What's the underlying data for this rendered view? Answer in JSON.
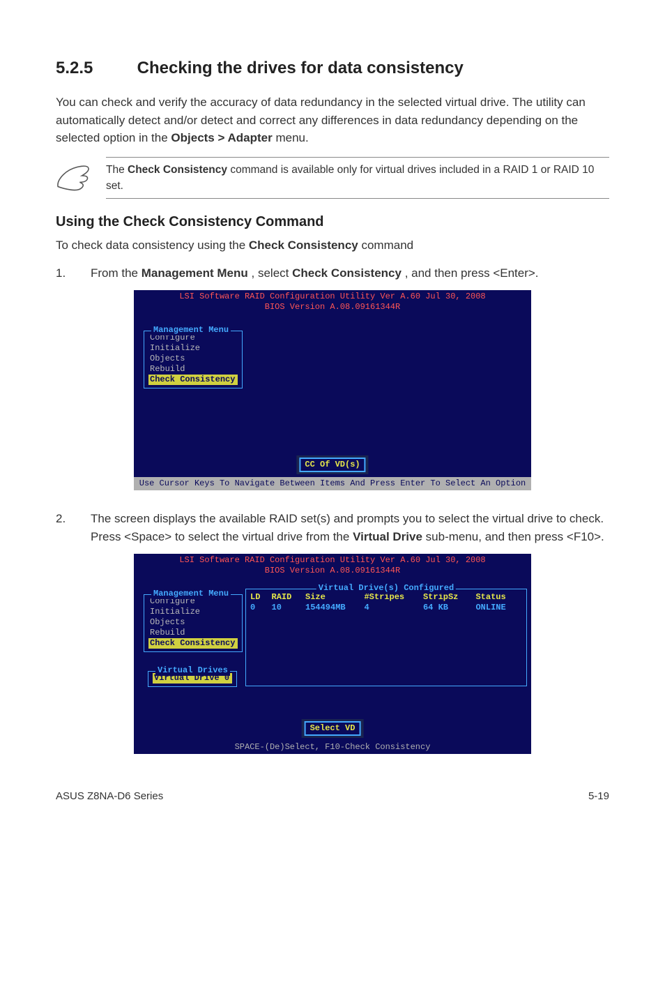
{
  "section": {
    "num": "5.2.5",
    "title": "Checking the drives for data consistency"
  },
  "intro": {
    "t1": "You can check and verify the accuracy of data redundancy in the selected virtual drive. The utility can automatically detect and/or detect and correct any differences in data redundancy depending on the selected option in the ",
    "b1": "Objects > Adapter",
    "t2": " menu."
  },
  "note": {
    "t1": "The ",
    "b1": "Check Consistency",
    "t2": " command is available only for virtual drives included in a RAID 1 or RAID 10 set."
  },
  "sub": {
    "title": "Using the Check Consistency Command"
  },
  "substep": {
    "t1": "To check data consistency using the ",
    "b1": "Check Consistency",
    "t2": " command"
  },
  "steps": {
    "s1": {
      "num": "1.",
      "t1": "From the ",
      "b1": "Management Menu",
      "t2": ", select ",
      "b2": "Check Consistency",
      "t3": ", and then press <Enter>."
    },
    "s2": {
      "num": "2.",
      "t1": "The screen displays the available RAID set(s) and prompts you to select the virtual drive to check. Press <Space> to select the virtual drive from the ",
      "b1": "Virtual Drive",
      "t2": " sub-menu, and then press <F10>."
    }
  },
  "bios1": {
    "hdr1": "LSI Software RAID Configuration Utility Ver A.60 Jul 30, 2008",
    "hdr2": "BIOS Version   A.08.09161344R",
    "menuTitle": "Management Menu",
    "items": {
      "i0": "Configure",
      "i1": "Initialize",
      "i2": "Objects",
      "i3": "Rebuild",
      "i4": "Check Consistency"
    },
    "cc": "CC Of VD(s)",
    "footer": "Use Cursor Keys To Navigate Between Items And Press Enter To Select An Option"
  },
  "bios2": {
    "hdr1": "LSI Software RAID Configuration Utility Ver A.60 Jul 30, 2008",
    "hdr2": "BIOS Version   A.08.09161344R",
    "menuTitle": "Management Menu",
    "items": {
      "i0": "Configure",
      "i1": "Initialize",
      "i2": "Objects",
      "i3": "Rebuild",
      "i4": "Check Consistency"
    },
    "vdMenuTitle": "Virtual Drives",
    "vdItem": "Virtual Drive 0",
    "vdTitle": "Virtual Drive(s) Configured",
    "cols": {
      "c0": "LD",
      "c1": "RAID",
      "c2": "Size",
      "c3": "#Stripes",
      "c4": "StripSz",
      "c5": "Status"
    },
    "row": {
      "c0": "0",
      "c1": "10",
      "c2": "154494MB",
      "c3": "4",
      "c4": "64 KB",
      "c5": "ONLINE"
    },
    "selvd": "Select VD",
    "footer": "SPACE-(De)Select,    F10-Check Consistency"
  },
  "footer": {
    "left": "ASUS Z8NA-D6 Series",
    "right": "5-19"
  }
}
